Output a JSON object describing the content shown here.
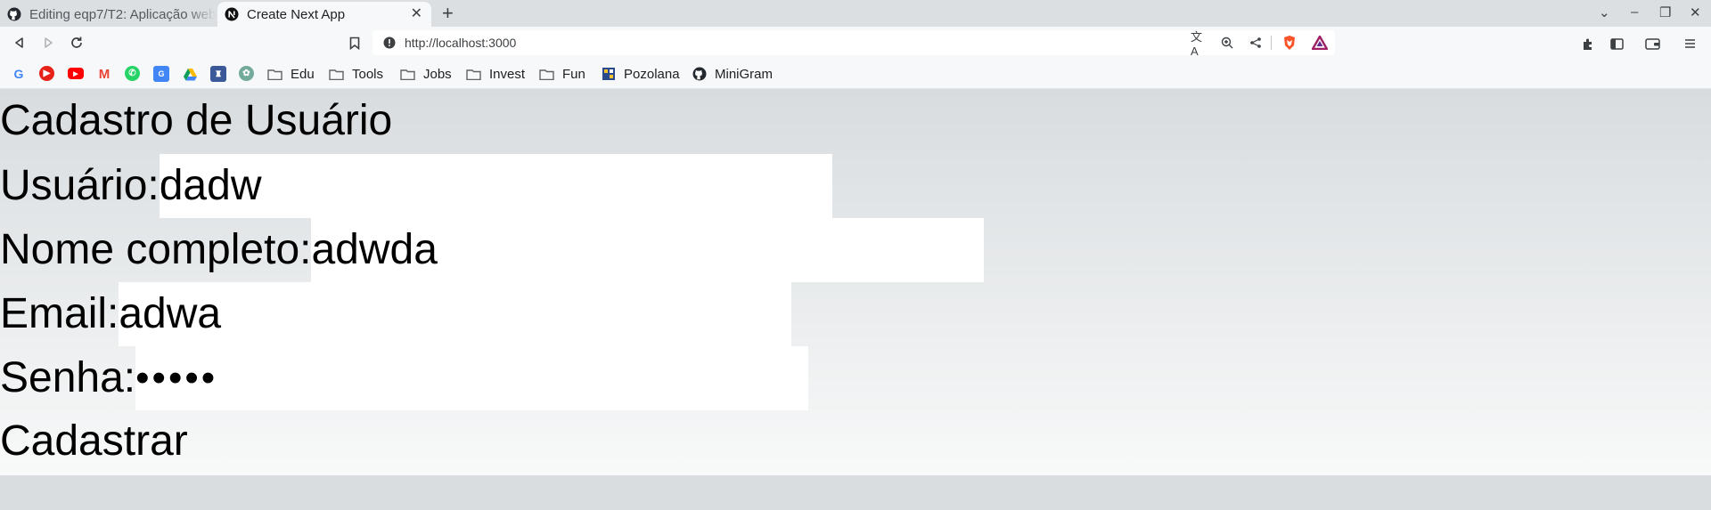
{
  "browser": {
    "tabs": [
      {
        "label": "Editing eqp7/T2: Aplicação web",
        "icon": "github-icon",
        "active": false
      },
      {
        "label": "Create Next App",
        "icon": "nextjs-icon",
        "active": true
      }
    ],
    "address": "http://localhost:3000",
    "bookmarks": [
      {
        "label": "Edu"
      },
      {
        "label": "Tools"
      },
      {
        "label": "Jobs"
      },
      {
        "label": "Invest"
      },
      {
        "label": "Fun"
      },
      {
        "label": "Pozolana"
      },
      {
        "label": "MiniGram"
      }
    ]
  },
  "form": {
    "title": "Cadastro de Usuário",
    "fields": [
      {
        "label": "Usuário:",
        "value": "dadw"
      },
      {
        "label": "Nome completo:",
        "value": "adwda"
      },
      {
        "label": "Email:",
        "value": "adwa"
      },
      {
        "label": "Senha:",
        "value": "•••••"
      }
    ],
    "submit_label": "Cadastrar"
  }
}
